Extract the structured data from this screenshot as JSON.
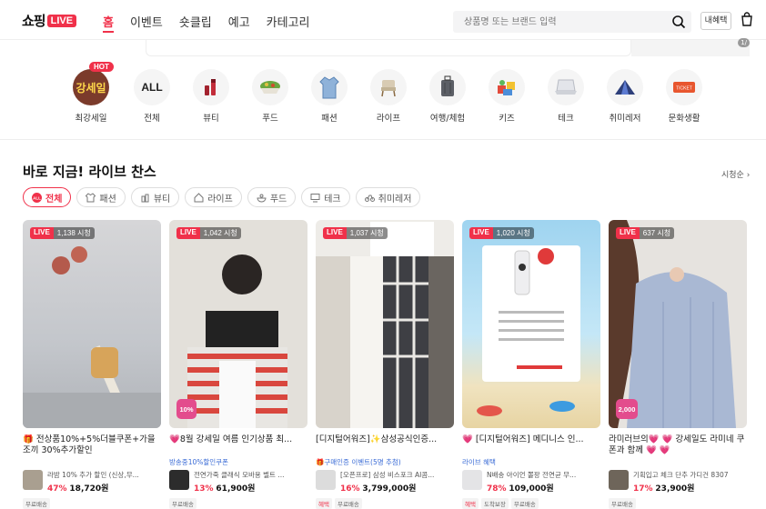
{
  "header": {
    "logo_text": "쇼핑",
    "logo_badge": "LIVE",
    "tabs": [
      {
        "label": "홈"
      },
      {
        "label": "이벤트"
      },
      {
        "label": "숏클립"
      },
      {
        "label": "예고"
      },
      {
        "label": "카테고리"
      }
    ],
    "search_placeholder": "상품명 또는 브랜드 입력",
    "my_button": "내혜택",
    "colors": {
      "accent": "#f0314a",
      "active_tab": "#f0314a"
    }
  },
  "categories": [
    {
      "label": "최강세일",
      "icon": "sale-badge-icon",
      "badge": "HOT",
      "inner": "강세일"
    },
    {
      "label": "전체",
      "icon": "all-icon",
      "inner": "ALL"
    },
    {
      "label": "뷰티",
      "icon": "lipstick-icon"
    },
    {
      "label": "푸드",
      "icon": "salad-bowl-icon"
    },
    {
      "label": "패션",
      "icon": "shirt-icon"
    },
    {
      "label": "라이프",
      "icon": "chair-icon"
    },
    {
      "label": "여행/체험",
      "icon": "suitcase-icon"
    },
    {
      "label": "키즈",
      "icon": "toy-icon"
    },
    {
      "label": "테크",
      "icon": "laptop-icon"
    },
    {
      "label": "취미레저",
      "icon": "tent-icon"
    },
    {
      "label": "문화생활",
      "icon": "ticket-icon"
    }
  ],
  "section": {
    "title": "바로 지금! 라이브 찬스",
    "sort": "시청순",
    "chips": [
      {
        "label": "전체",
        "icon": "all-icon"
      },
      {
        "label": "패션",
        "icon": "shirt-icon"
      },
      {
        "label": "뷰티",
        "icon": "lipstick-icon"
      },
      {
        "label": "라이프",
        "icon": "home-icon"
      },
      {
        "label": "푸드",
        "icon": "food-icon"
      },
      {
        "label": "테크",
        "icon": "monitor-icon"
      },
      {
        "label": "취미레저",
        "icon": "bike-icon"
      }
    ]
  },
  "cards": [
    {
      "live": "LIVE",
      "viewers": "1,138 시청",
      "title": "🎁 전상품10%+5%더블쿠폰+가을조끼 30%추가할인",
      "subtitle": "",
      "product": "라밤 10% 추가 할인 (신상,무...",
      "discount": "47%",
      "price": "18,720원",
      "tags": [
        "무료배송"
      ],
      "thumb_color": "#c9ccd1"
    },
    {
      "live": "LIVE",
      "viewers": "1,042 시청",
      "pct": "10%",
      "title": "💗8월 강세일 여름 인기상품 최...",
      "subtitle": "방송중10%할인쿠폰",
      "product": "전연가죽 클래식 모바용 벨트 ...",
      "discount": "13%",
      "price": "61,900원",
      "tags": [
        "무료배송"
      ],
      "thumb_color": "#d9d7d2"
    },
    {
      "live": "LIVE",
      "viewers": "1,037 시청",
      "title": "[디지털어워즈]✨삼성공식인증...",
      "subtitle": "🎁구매인증 이벤트(5명 추첨)",
      "product": "[오픈프로] 삼성 비스포크 AI콤...",
      "discount": "16%",
      "price": "3,799,000원",
      "tags": [
        "혜택",
        "무료배송"
      ],
      "thumb_color": "#e8e6e2"
    },
    {
      "live": "LIVE",
      "viewers": "1,020 시청",
      "title": "💗 [디지털어워즈] 메디니스 인...",
      "subtitle": "라이브 혜택",
      "product": "N배송 아이언 뽈팡 전연균 무...",
      "discount": "78%",
      "price": "109,000원",
      "tags": [
        "혜택",
        "도착보장",
        "무료배송"
      ],
      "thumb_color": "#bfe3f5"
    },
    {
      "live": "LIVE",
      "viewers": "637 시청",
      "pct": "2,000",
      "title": "라미러브의💗 💗 강세일도 라미네 쿠폰과 함께 💗 💗",
      "subtitle": "",
      "product": "기획입고 체크 단추 가디건 8307",
      "discount": "17%",
      "price": "23,900원",
      "tags": [
        "무료배송"
      ],
      "thumb_color": "#b9c7df"
    }
  ]
}
